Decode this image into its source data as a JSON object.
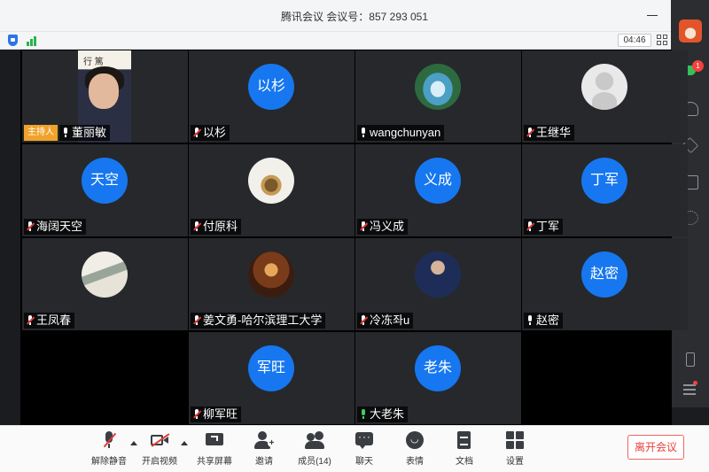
{
  "window": {
    "title": "腾讯会议 会议号：857 293 051",
    "timer": "04:46"
  },
  "sidebar": {
    "chat_badge": "1"
  },
  "participants": [
    {
      "name": "董丽敏",
      "host_label": "主持人",
      "type": "camera",
      "mic": "on"
    },
    {
      "name": "以杉",
      "avatar_text": "以杉",
      "type": "initials",
      "mic": "muted"
    },
    {
      "name": "wangchunyan",
      "type": "photo",
      "photo": "river-waterfall",
      "mic": "on"
    },
    {
      "name": "王继华",
      "type": "photo",
      "photo": "default-person",
      "mic": "muted"
    },
    {
      "name": "海阔天空",
      "avatar_text": "天空",
      "type": "initials",
      "mic": "muted"
    },
    {
      "name": "付原科",
      "type": "photo",
      "photo": "deer-illustration",
      "mic": "muted"
    },
    {
      "name": "冯义成",
      "avatar_text": "义成",
      "type": "initials",
      "mic": "muted"
    },
    {
      "name": "丁军",
      "avatar_text": "丁军",
      "type": "initials",
      "mic": "muted"
    },
    {
      "name": "王凤春",
      "type": "photo",
      "photo": "landscape-painting",
      "mic": "muted"
    },
    {
      "name": "姜文勇-哈尔滨理工大学",
      "type": "photo",
      "photo": "room-interior",
      "mic": "muted"
    },
    {
      "name": "冷冻좌u",
      "type": "photo",
      "photo": "man-portrait",
      "mic": "muted"
    },
    {
      "name": "赵密",
      "avatar_text": "赵密",
      "type": "initials",
      "mic": "on"
    },
    {
      "name": "柳军旺",
      "avatar_text": "军旺",
      "type": "initials",
      "mic": "muted"
    },
    {
      "name": "大老朱",
      "avatar_text": "老朱",
      "type": "initials",
      "mic": "on-green"
    }
  ],
  "toolbar": {
    "unmute": "解除静音",
    "start_video": "开启视频",
    "share_screen": "共享屏幕",
    "invite": "邀请",
    "members": "成员(14)",
    "chat": "聊天",
    "reactions": "表情",
    "documents": "文档",
    "settings": "设置",
    "leave": "离开会议"
  },
  "colors": {
    "avatar_blue": "#1677f0",
    "host_orange": "#f1a22a",
    "leave_red": "#e8403b",
    "chat_green": "#33c25a"
  }
}
